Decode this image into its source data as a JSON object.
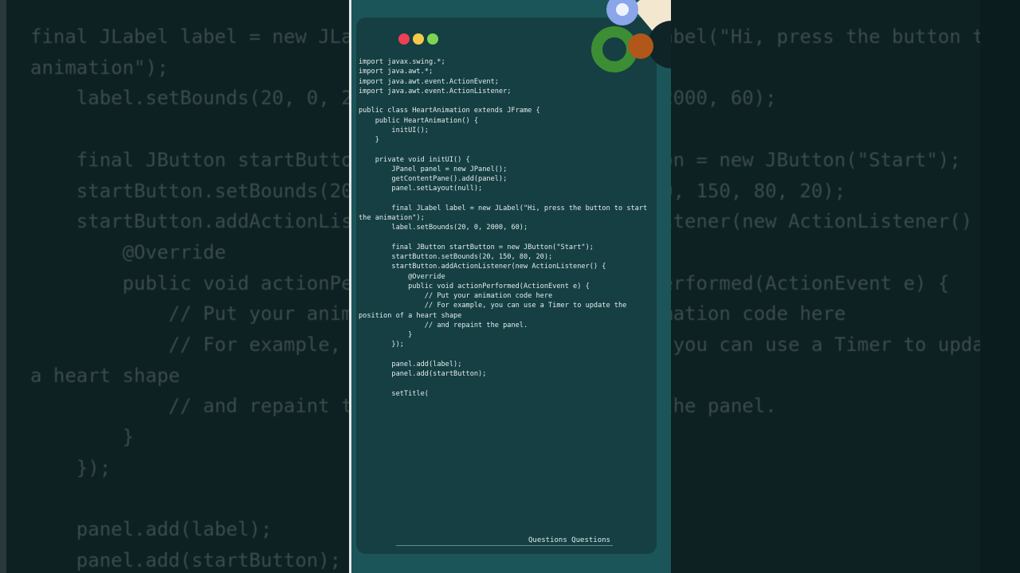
{
  "background_code": "final JLabel label = new JLabel(\"Hi, press the button to start the\nanimation\");\n    label.setBounds(20, 0, 2000, 60);\n\n    final JButton startButton = new JButton(\"Start\");\n    startButton.setBounds(20, 150, 80, 20);\n    startButton.addActionListener(new ActionListener() {\n        @Override\n        public void actionPerformed(ActionEvent e) {\n            // Put your animation code here\n            // For example, you can use a Timer to update the position of\na heart shape\n            // and repaint the panel.\n        }\n    });\n\n    panel.add(label);\n    panel.add(startButton);",
  "code": "import javax.swing.*;\nimport java.awt.*;\nimport java.awt.event.ActionEvent;\nimport java.awt.event.ActionListener;\n\npublic class HeartAnimation extends JFrame {\n    public HeartAnimation() {\n        initUI();\n    }\n\n    private void initUI() {\n        JPanel panel = new JPanel();\n        getContentPane().add(panel);\n        panel.setLayout(null);\n\n        final JLabel label = new JLabel(\"Hi, press the button to start the animation\");\n        label.setBounds(20, 0, 2000, 60);\n\n        final JButton startButton = new JButton(\"Start\");\n        startButton.setBounds(20, 150, 80, 20);\n        startButton.addActionListener(new ActionListener() {\n            @Override\n            public void actionPerformed(ActionEvent e) {\n                // Put your animation code here\n                // For example, you can use a Timer to update the position of a heart shape\n                // and repaint the panel.\n            }\n        });\n\n        panel.add(label);\n        panel.add(startButton);\n\n        setTitle(",
  "footer_text": "Questions Questions",
  "window_controls": [
    "close",
    "minimize",
    "maximize"
  ],
  "colors": {
    "panel_bg": "#1b5559",
    "card_bg": "#153f43",
    "dot_red": "#ee3f56",
    "dot_yellow": "#f4c94a",
    "dot_green": "#7bd553"
  }
}
